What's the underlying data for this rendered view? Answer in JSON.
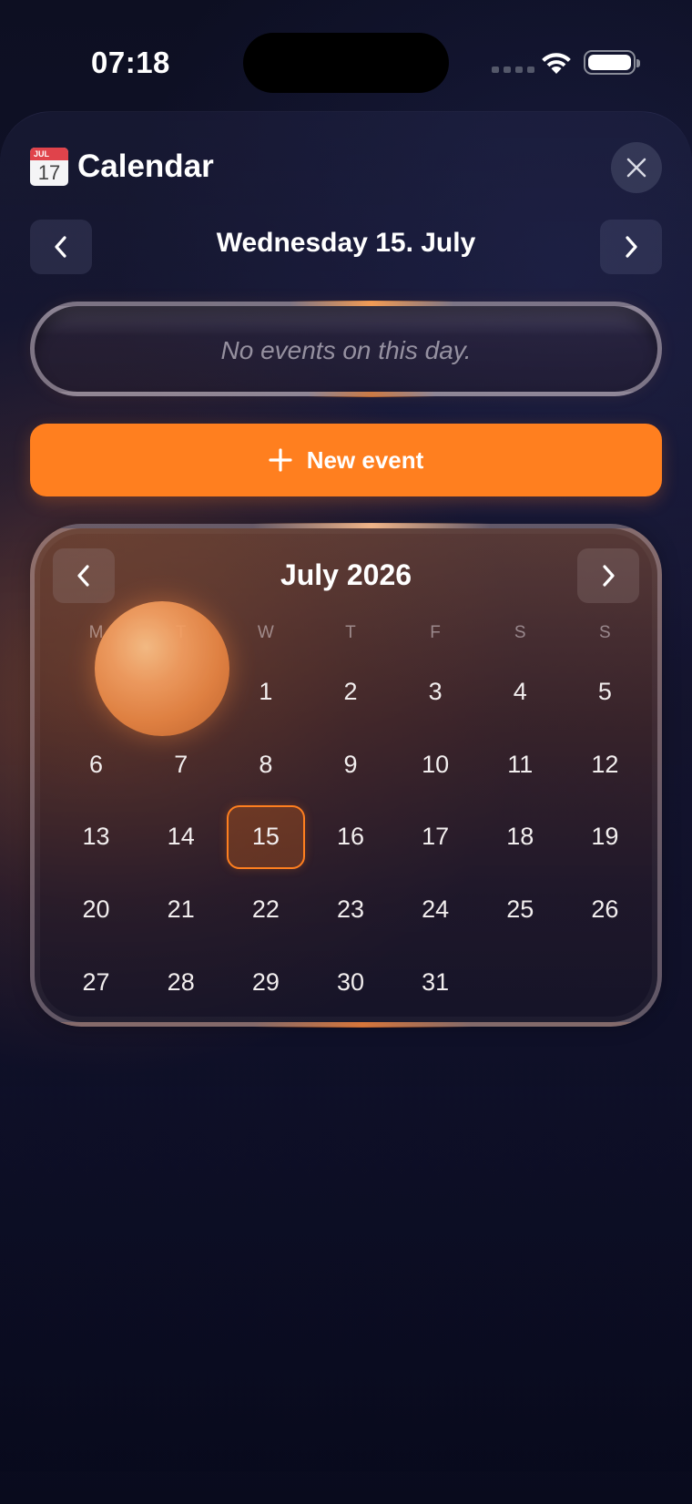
{
  "status_bar": {
    "time": "07:18"
  },
  "header": {
    "icon": "calendar-emoji-icon",
    "icon_month": "JUL",
    "icon_day": "17",
    "title": "Calendar"
  },
  "day_nav": {
    "title": "Wednesday 15. July"
  },
  "events": {
    "empty_text": "No events on this day."
  },
  "new_event": {
    "label": "New event"
  },
  "calendar": {
    "month_title": "July 2026",
    "weekdays": [
      "M",
      "T",
      "W",
      "T",
      "F",
      "S",
      "S"
    ],
    "leading_blanks": 2,
    "days": [
      "1",
      "2",
      "3",
      "4",
      "5",
      "6",
      "7",
      "8",
      "9",
      "10",
      "11",
      "12",
      "13",
      "14",
      "15",
      "16",
      "17",
      "18",
      "19",
      "20",
      "21",
      "22",
      "23",
      "24",
      "25",
      "26",
      "27",
      "28",
      "29",
      "30",
      "31"
    ],
    "selected_day": "15"
  },
  "colors": {
    "accent": "#ff7f1f",
    "background": "#0f1028"
  }
}
